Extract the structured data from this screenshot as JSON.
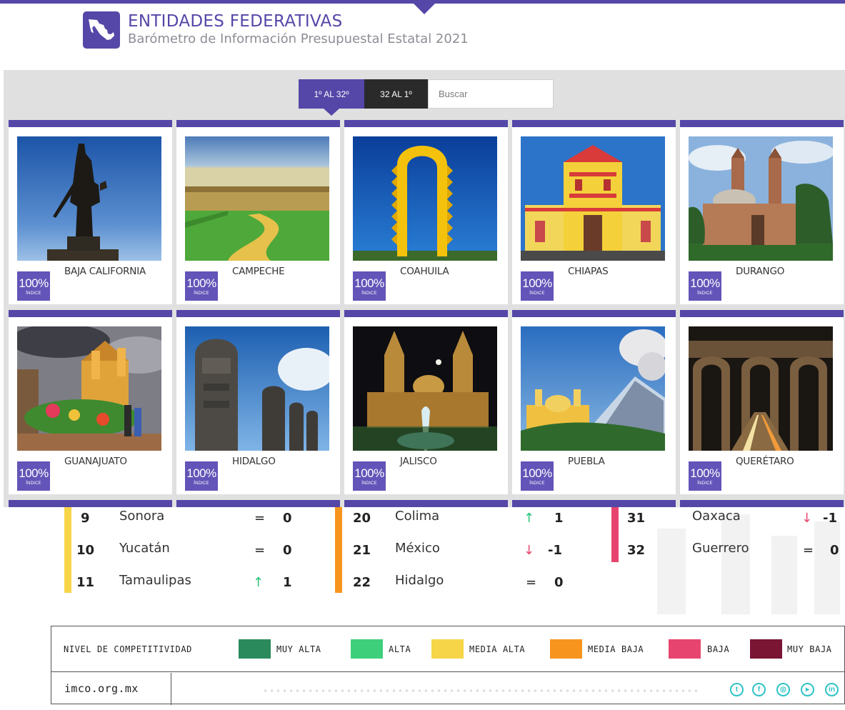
{
  "header": {
    "title": "ENTIDADES FEDERATIVAS",
    "subtitle": "Barómetro de Información Presupuestal Estatal 2021",
    "logo_icon": "mexico-map-icon"
  },
  "toolbar": {
    "sort_asc_label": "1º AL 32º",
    "sort_desc_label": "32 AL 1º",
    "search_placeholder": "Buscar",
    "search_value": ""
  },
  "cards": [
    {
      "name": "BAJA CALIFORNIA",
      "score": "100%",
      "score_label": "ÍNDICE",
      "photo": "statue-monument"
    },
    {
      "name": "CAMPECHE",
      "score": "100%",
      "score_label": "ÍNDICE",
      "photo": "fort-wall"
    },
    {
      "name": "COAHUILA",
      "score": "100%",
      "score_label": "ÍNDICE",
      "photo": "yellow-arch-monument"
    },
    {
      "name": "CHIAPAS",
      "score": "100%",
      "score_label": "ÍNDICE",
      "photo": "yellow-cathedral"
    },
    {
      "name": "DURANGO",
      "score": "100%",
      "score_label": "ÍNDICE",
      "photo": "domed-cathedral"
    },
    {
      "name": "GUANAJUATO",
      "score": "100%",
      "score_label": "ÍNDICE",
      "photo": "colonial-city"
    },
    {
      "name": "HIDALGO",
      "score": "100%",
      "score_label": "ÍNDICE",
      "photo": "stone-atlantes"
    },
    {
      "name": "JALISCO",
      "score": "100%",
      "score_label": "ÍNDICE",
      "photo": "night-cathedral-fountain"
    },
    {
      "name": "PUEBLA",
      "score": "100%",
      "score_label": "ÍNDICE",
      "photo": "volcano-church"
    },
    {
      "name": "QUERÉTARO",
      "score": "100%",
      "score_label": "ÍNDICE",
      "photo": "night-aqueduct"
    }
  ],
  "ranking": [
    {
      "rank": "9",
      "state": "Sonora",
      "symbol": "=",
      "change": "0",
      "group": "media-alta"
    },
    {
      "rank": "10",
      "state": "Yucatán",
      "symbol": "=",
      "change": "0",
      "group": "media-alta"
    },
    {
      "rank": "11",
      "state": "Tamaulipas",
      "symbol": "↑",
      "change": "1",
      "group": "media-alta"
    },
    {
      "rank": "20",
      "state": "Colima",
      "symbol": "↑",
      "change": "1",
      "group": "media-baja"
    },
    {
      "rank": "21",
      "state": "México",
      "symbol": "↓",
      "change": "-1",
      "group": "media-baja"
    },
    {
      "rank": "22",
      "state": "Hidalgo",
      "symbol": "=",
      "change": "0",
      "group": "media-baja"
    },
    {
      "rank": "31",
      "state": "Oaxaca",
      "symbol": "↓",
      "change": "-1",
      "group": "baja"
    },
    {
      "rank": "32",
      "state": "Guerrero",
      "symbol": "=",
      "change": "0",
      "group": "baja"
    }
  ],
  "legend": {
    "title": "NIVEL DE COMPETITIVIDAD",
    "items": [
      {
        "label": "MUY ALTA",
        "color": "#2a8a5c"
      },
      {
        "label": "ALTA",
        "color": "#3ecf7b"
      },
      {
        "label": "MEDIA ALTA",
        "color": "#f7d548"
      },
      {
        "label": "MEDIA BAJA",
        "color": "#f7941d"
      },
      {
        "label": "BAJA",
        "color": "#e7456f"
      },
      {
        "label": "MUY BAJA",
        "color": "#7a1534"
      }
    ]
  },
  "footer": {
    "url": "imco.org.mx",
    "social": [
      "twitter-icon",
      "facebook-icon",
      "instagram-icon",
      "youtube-icon",
      "linkedin-icon"
    ]
  },
  "colors": {
    "accent": "#5447a8",
    "up": "#20c474",
    "down": "#e7456f"
  }
}
